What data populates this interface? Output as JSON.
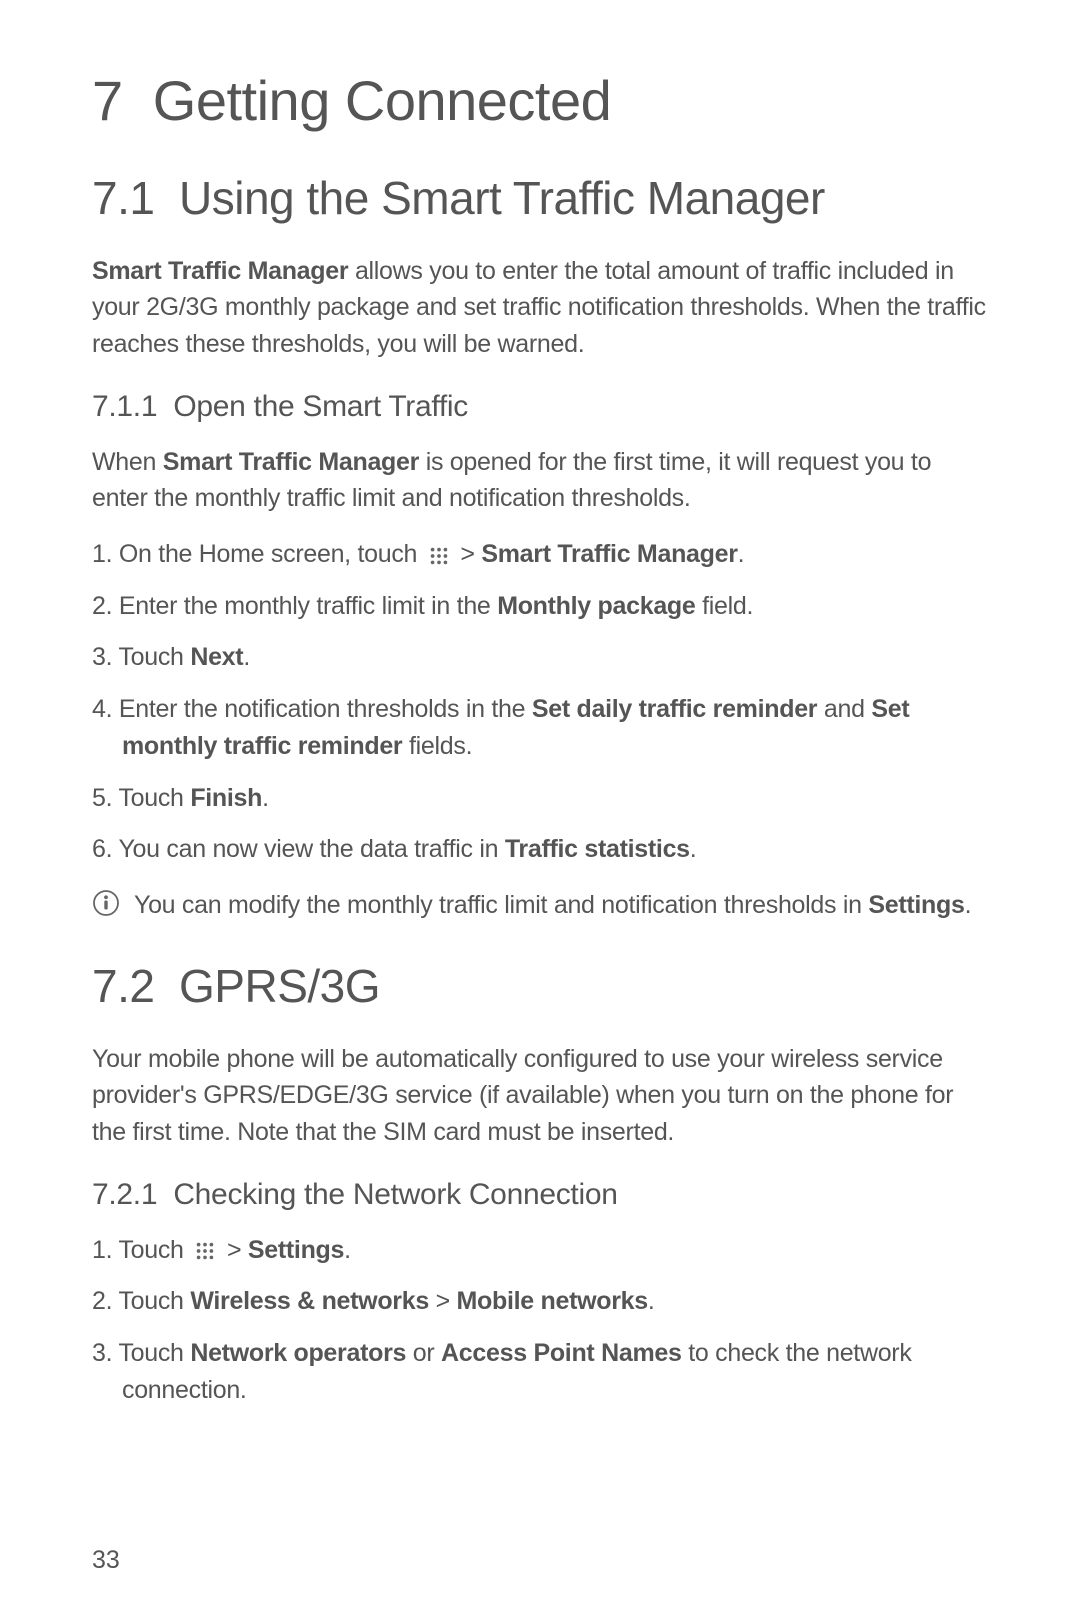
{
  "chapter": {
    "number": "7",
    "title": "Getting Connected"
  },
  "section_7_1": {
    "number": "7.1",
    "title": "Using the Smart Traffic Manager",
    "intro": {
      "bold": "Smart Traffic Manager",
      "rest": " allows you to enter the total amount of traffic included in your 2G/3G monthly package and set traffic notification thresholds. When the traffic reaches these thresholds, you will be warned."
    },
    "sub_7_1_1": {
      "number": "7.1.1",
      "title": "Open the Smart Traffic",
      "intro": {
        "pre": "When ",
        "bold": "Smart Traffic Manager",
        "post": " is opened for the first time, it will request you to enter the monthly traffic limit and notification thresholds."
      },
      "steps": {
        "s1": {
          "num": "1.",
          "pre": "On the Home screen, touch ",
          "mid": " > ",
          "bold1": "Smart Traffic Manager",
          "end": "."
        },
        "s2": {
          "num": "2.",
          "pre": "Enter the monthly traffic limit in the ",
          "bold1": "Monthly package",
          "end": " field."
        },
        "s3": {
          "num": "3.",
          "pre": "Touch ",
          "bold1": "Next",
          "end": "."
        },
        "s4": {
          "num": "4.",
          "pre": "Enter the notification thresholds in the ",
          "bold1": "Set daily traffic reminder",
          "mid": " and ",
          "bold2": "Set monthly traffic reminder",
          "end": " fields."
        },
        "s5": {
          "num": "5.",
          "pre": "Touch ",
          "bold1": "Finish",
          "end": "."
        },
        "s6": {
          "num": "6.",
          "pre": "You can now view the data traffic in ",
          "bold1": "Traffic statistics",
          "end": "."
        }
      },
      "note": {
        "pre": "You can modify the monthly traffic limit and notification thresholds in ",
        "bold": "Settings",
        "end": "."
      }
    }
  },
  "section_7_2": {
    "number": "7.2",
    "title": "GPRS/3G",
    "intro": "Your mobile phone will be automatically configured to use your wireless service provider's GPRS/EDGE/3G service (if available) when you turn on the phone for the first time. Note that the SIM card must be inserted.",
    "sub_7_2_1": {
      "number": "7.2.1",
      "title": "Checking the Network Connection",
      "steps": {
        "s1": {
          "num": "1.",
          "pre": "Touch ",
          "mid": " > ",
          "bold1": "Settings",
          "end": "."
        },
        "s2": {
          "num": "2.",
          "pre": "Touch ",
          "bold1": "Wireless & networks",
          "mid": " > ",
          "bold2": "Mobile networks",
          "end": "."
        },
        "s3": {
          "num": "3.",
          "pre": "Touch ",
          "bold1": "Network operators",
          "mid": " or ",
          "bold2": "Access Point Names",
          "end": " to check the network connection."
        }
      }
    }
  },
  "page_number": "33"
}
